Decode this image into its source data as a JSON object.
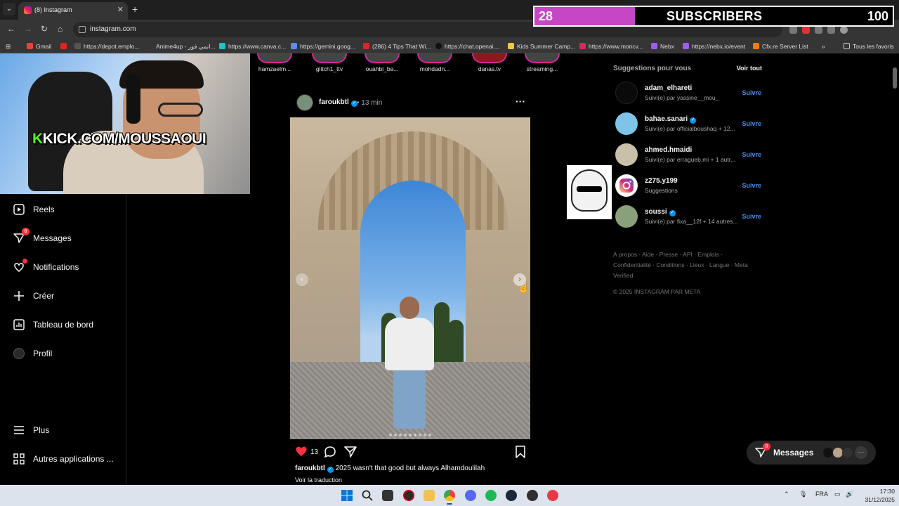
{
  "browser": {
    "tab_title": "(8) Instagram",
    "url": "instagram.com",
    "bookmarks": [
      "Gmail",
      "https://depot.emplo...",
      "Anime4up - انمي فور...",
      "https://www.canva.c...",
      "https://gemini.goog...",
      "(286) 4 Tips That Wi...",
      "https://chat.openai....",
      "Kids Summer Camp...",
      "https://www.moncv...",
      "Nebx",
      "https://nebx.io/event",
      "Cfx.re Server List",
      "Tous les favoris"
    ]
  },
  "overlay": {
    "sub_count": "28",
    "sub_label": "SUBSCRIBERS",
    "sub_goal": "100",
    "sub_progress": 0.28,
    "kick_k": "K",
    "kick_text": "KICK.COM/MOUSSAOUI"
  },
  "sidebar": {
    "items": [
      {
        "label": "Reels"
      },
      {
        "label": "Messages",
        "badge": "8"
      },
      {
        "label": "Notifications"
      },
      {
        "label": "Créer"
      },
      {
        "label": "Tableau de bord"
      },
      {
        "label": "Profil"
      }
    ],
    "more": "Plus",
    "apps": "Autres applications ..."
  },
  "stories": [
    "hamzaelm...",
    "glitch1_ttv",
    "ouahbi_ba...",
    "mohdadn...",
    "danas.tv",
    "streaming..."
  ],
  "post": {
    "username": "faroukbtl",
    "time": "13 min",
    "likes": "13",
    "caption_user": "faroukbtl",
    "caption_text": "2025 wasn't that good but always Alhamdoulilah",
    "translate": "Voir la traduction",
    "carousel_total": 9
  },
  "suggestions": {
    "title": "Suggestions pour vous",
    "see_all": "Voir tout",
    "follow_label": "Suivre",
    "items": [
      {
        "name": "adam_elhareti",
        "sub": "Suivi(e) par yassine__mou_"
      },
      {
        "name": "bahae.sanari",
        "sub": "Suivi(e) par officialboushaq + 12...",
        "verified": true
      },
      {
        "name": "ahmed.hmaidi",
        "sub": "Suivi(e) par erragueb.mi + 1 autr..."
      },
      {
        "name": "z275.y199",
        "sub": "Suggestions"
      },
      {
        "name": "soussi",
        "sub": "Suivi(e) par fixa__12f + 14 autres...",
        "verified": true
      }
    ]
  },
  "footer": {
    "links": "À propos · Aide · Presse · API · Emplois · Confidentialité · Conditions · Lieux · Langue · Meta Verified",
    "copyright": "© 2025 INSTAGRAM PAR META"
  },
  "messages_pill": {
    "label": "Messages",
    "badge": "8"
  },
  "taskbar": {
    "language": "FRA",
    "time": "17:30",
    "date": "31/12/2025"
  },
  "colors": {
    "accent": "#0095f6",
    "notification": "#ff3040",
    "sub_bar": "#c646c6",
    "kick_green": "#53fc18"
  }
}
